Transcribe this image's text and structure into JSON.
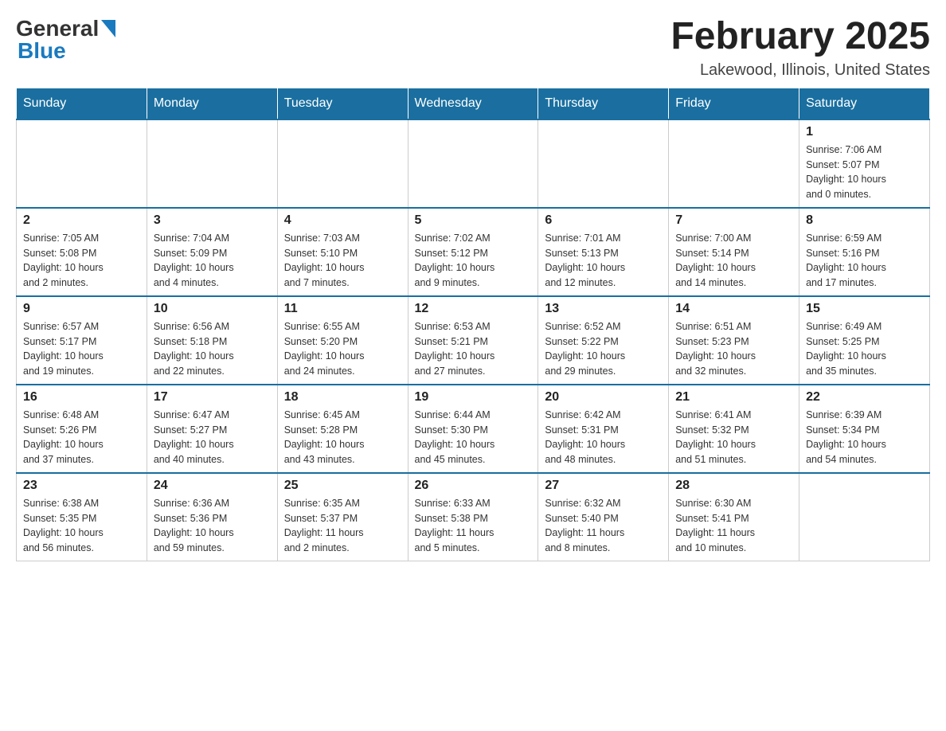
{
  "header": {
    "logo_general": "General",
    "logo_blue": "Blue",
    "month_title": "February 2025",
    "location": "Lakewood, Illinois, United States"
  },
  "days_of_week": [
    "Sunday",
    "Monday",
    "Tuesday",
    "Wednesday",
    "Thursday",
    "Friday",
    "Saturday"
  ],
  "weeks": [
    [
      {
        "day": "",
        "info": ""
      },
      {
        "day": "",
        "info": ""
      },
      {
        "day": "",
        "info": ""
      },
      {
        "day": "",
        "info": ""
      },
      {
        "day": "",
        "info": ""
      },
      {
        "day": "",
        "info": ""
      },
      {
        "day": "1",
        "info": "Sunrise: 7:06 AM\nSunset: 5:07 PM\nDaylight: 10 hours\nand 0 minutes."
      }
    ],
    [
      {
        "day": "2",
        "info": "Sunrise: 7:05 AM\nSunset: 5:08 PM\nDaylight: 10 hours\nand 2 minutes."
      },
      {
        "day": "3",
        "info": "Sunrise: 7:04 AM\nSunset: 5:09 PM\nDaylight: 10 hours\nand 4 minutes."
      },
      {
        "day": "4",
        "info": "Sunrise: 7:03 AM\nSunset: 5:10 PM\nDaylight: 10 hours\nand 7 minutes."
      },
      {
        "day": "5",
        "info": "Sunrise: 7:02 AM\nSunset: 5:12 PM\nDaylight: 10 hours\nand 9 minutes."
      },
      {
        "day": "6",
        "info": "Sunrise: 7:01 AM\nSunset: 5:13 PM\nDaylight: 10 hours\nand 12 minutes."
      },
      {
        "day": "7",
        "info": "Sunrise: 7:00 AM\nSunset: 5:14 PM\nDaylight: 10 hours\nand 14 minutes."
      },
      {
        "day": "8",
        "info": "Sunrise: 6:59 AM\nSunset: 5:16 PM\nDaylight: 10 hours\nand 17 minutes."
      }
    ],
    [
      {
        "day": "9",
        "info": "Sunrise: 6:57 AM\nSunset: 5:17 PM\nDaylight: 10 hours\nand 19 minutes."
      },
      {
        "day": "10",
        "info": "Sunrise: 6:56 AM\nSunset: 5:18 PM\nDaylight: 10 hours\nand 22 minutes."
      },
      {
        "day": "11",
        "info": "Sunrise: 6:55 AM\nSunset: 5:20 PM\nDaylight: 10 hours\nand 24 minutes."
      },
      {
        "day": "12",
        "info": "Sunrise: 6:53 AM\nSunset: 5:21 PM\nDaylight: 10 hours\nand 27 minutes."
      },
      {
        "day": "13",
        "info": "Sunrise: 6:52 AM\nSunset: 5:22 PM\nDaylight: 10 hours\nand 29 minutes."
      },
      {
        "day": "14",
        "info": "Sunrise: 6:51 AM\nSunset: 5:23 PM\nDaylight: 10 hours\nand 32 minutes."
      },
      {
        "day": "15",
        "info": "Sunrise: 6:49 AM\nSunset: 5:25 PM\nDaylight: 10 hours\nand 35 minutes."
      }
    ],
    [
      {
        "day": "16",
        "info": "Sunrise: 6:48 AM\nSunset: 5:26 PM\nDaylight: 10 hours\nand 37 minutes."
      },
      {
        "day": "17",
        "info": "Sunrise: 6:47 AM\nSunset: 5:27 PM\nDaylight: 10 hours\nand 40 minutes."
      },
      {
        "day": "18",
        "info": "Sunrise: 6:45 AM\nSunset: 5:28 PM\nDaylight: 10 hours\nand 43 minutes."
      },
      {
        "day": "19",
        "info": "Sunrise: 6:44 AM\nSunset: 5:30 PM\nDaylight: 10 hours\nand 45 minutes."
      },
      {
        "day": "20",
        "info": "Sunrise: 6:42 AM\nSunset: 5:31 PM\nDaylight: 10 hours\nand 48 minutes."
      },
      {
        "day": "21",
        "info": "Sunrise: 6:41 AM\nSunset: 5:32 PM\nDaylight: 10 hours\nand 51 minutes."
      },
      {
        "day": "22",
        "info": "Sunrise: 6:39 AM\nSunset: 5:34 PM\nDaylight: 10 hours\nand 54 minutes."
      }
    ],
    [
      {
        "day": "23",
        "info": "Sunrise: 6:38 AM\nSunset: 5:35 PM\nDaylight: 10 hours\nand 56 minutes."
      },
      {
        "day": "24",
        "info": "Sunrise: 6:36 AM\nSunset: 5:36 PM\nDaylight: 10 hours\nand 59 minutes."
      },
      {
        "day": "25",
        "info": "Sunrise: 6:35 AM\nSunset: 5:37 PM\nDaylight: 11 hours\nand 2 minutes."
      },
      {
        "day": "26",
        "info": "Sunrise: 6:33 AM\nSunset: 5:38 PM\nDaylight: 11 hours\nand 5 minutes."
      },
      {
        "day": "27",
        "info": "Sunrise: 6:32 AM\nSunset: 5:40 PM\nDaylight: 11 hours\nand 8 minutes."
      },
      {
        "day": "28",
        "info": "Sunrise: 6:30 AM\nSunset: 5:41 PM\nDaylight: 11 hours\nand 10 minutes."
      },
      {
        "day": "",
        "info": ""
      }
    ]
  ]
}
